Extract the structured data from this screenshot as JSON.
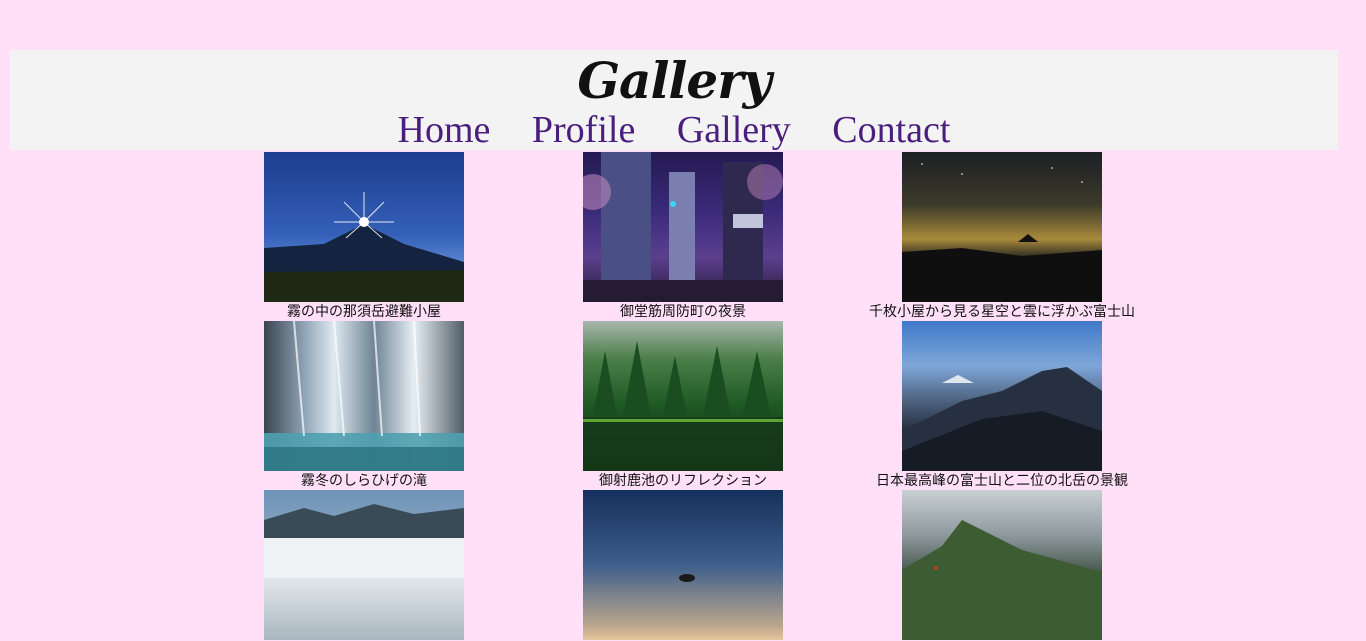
{
  "site": {
    "title": "Gallery"
  },
  "nav": {
    "items": [
      "Home",
      "Profile",
      "Gallery",
      "Contact"
    ]
  },
  "gallery": {
    "items": [
      {
        "caption": "霧の中の那須岳避難小屋"
      },
      {
        "caption": "御堂筋周防町の夜景"
      },
      {
        "caption": "千枚小屋から見る星空と雲に浮かぶ富士山"
      },
      {
        "caption": "霧冬のしらひげの滝"
      },
      {
        "caption": "御射鹿池のリフレクション"
      },
      {
        "caption": "日本最高峰の富士山と二位の北岳の景観"
      },
      {
        "caption": ""
      },
      {
        "caption": ""
      },
      {
        "caption": ""
      }
    ]
  },
  "colors": {
    "page_background": "#ffe0f8",
    "header_background": "#f3f3f3",
    "nav_link": "#4a1e7e"
  }
}
